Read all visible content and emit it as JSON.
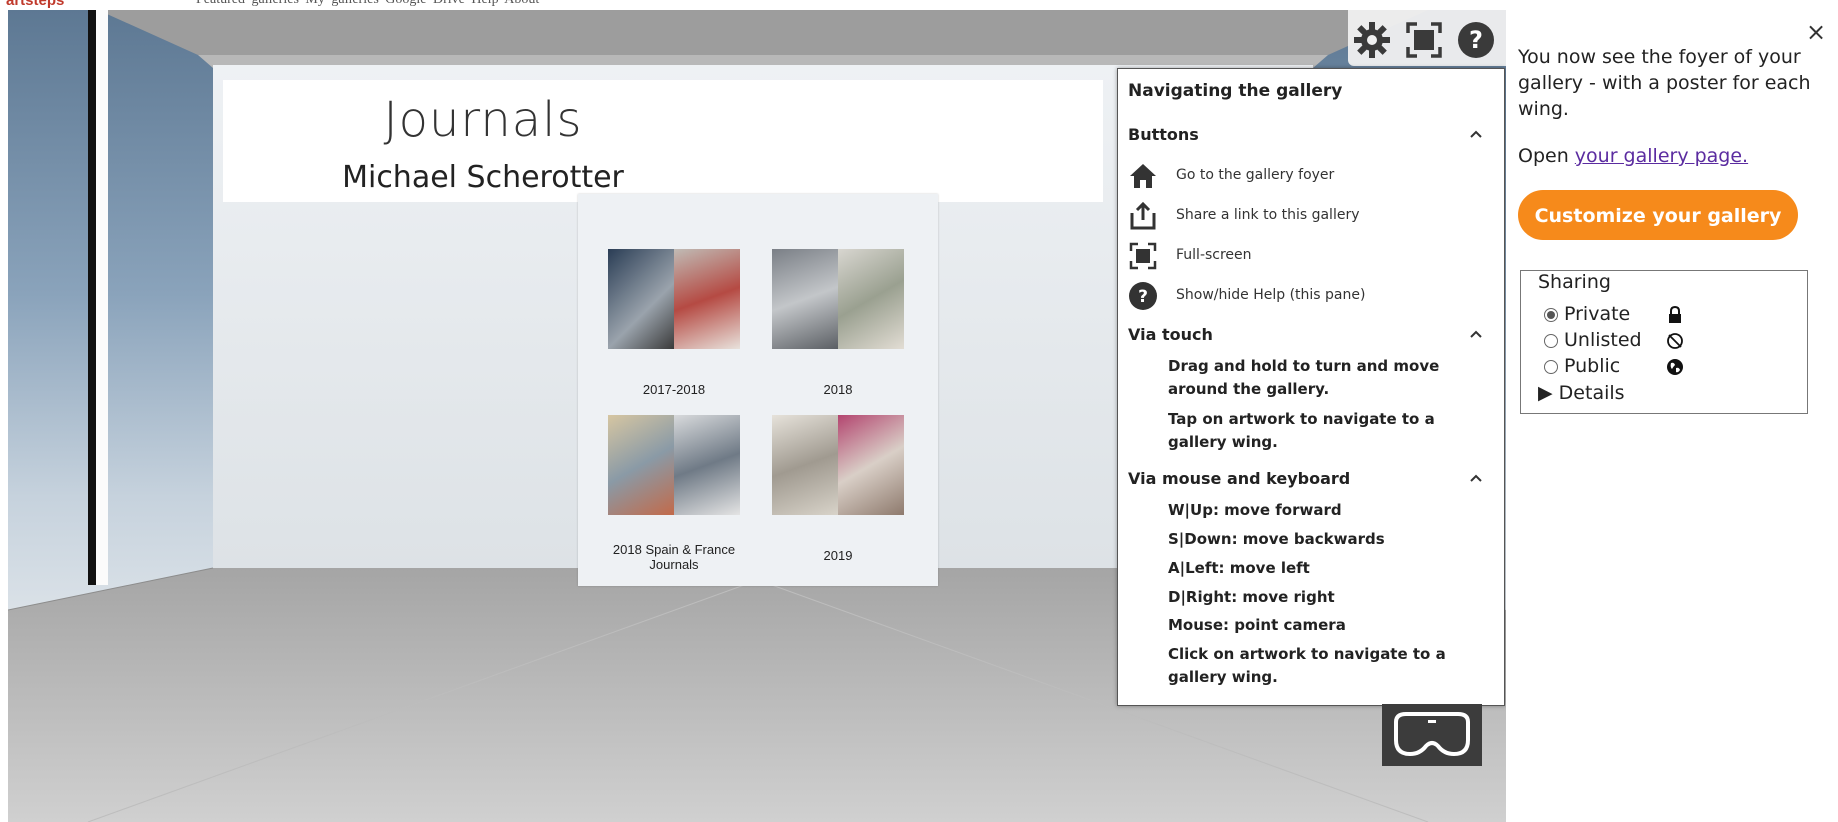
{
  "top_strip": {
    "logo": "artsteps",
    "nav": "Featured galleries   My galleries   Google Drive   Help   About"
  },
  "gallery": {
    "banner_title": "Journals",
    "banner_subtitle": "Michael Scherotter",
    "poster_items": [
      {
        "label": "2017-2018"
      },
      {
        "label": "2018"
      },
      {
        "label": "2018 Spain & France Journals"
      },
      {
        "label": "2019"
      }
    ]
  },
  "toolbar": {
    "icons": [
      "gear-icon",
      "fullscreen-icon",
      "help-icon"
    ]
  },
  "help_pane": {
    "title": "Navigating the gallery",
    "sections": {
      "buttons": "Buttons",
      "touch": "Via touch",
      "mouse": "Via mouse and keyboard"
    },
    "buttons": [
      {
        "icon": "home-icon",
        "text": "Go to the gallery foyer"
      },
      {
        "icon": "share-icon",
        "text": "Share a link to this gallery"
      },
      {
        "icon": "fullscreen-icon",
        "text": "Full-screen"
      },
      {
        "icon": "help-icon",
        "text": "Show/hide Help (this pane)"
      }
    ],
    "touch": [
      "Drag and hold to turn and move around the gallery.",
      "Tap on artwork to navigate to a gallery wing."
    ],
    "mouse": [
      "W|Up: move forward",
      "S|Down: move backwards",
      "A|Left: move left",
      "D|Right: move right",
      "Mouse: point camera",
      "Click on artwork to navigate to a gallery wing."
    ]
  },
  "side_panel": {
    "close": "×",
    "intro": "You now see the foyer of your gallery - with a poster for each wing.",
    "open_prefix": "Open ",
    "open_link": "your gallery page.",
    "customize_button": "Customize your gallery",
    "sharing": {
      "legend": "Sharing",
      "options": [
        {
          "label": "Private",
          "selected": true,
          "icon": "lock-icon"
        },
        {
          "label": "Unlisted",
          "selected": false,
          "icon": "unlisted-icon"
        },
        {
          "label": "Public",
          "selected": false,
          "icon": "globe-icon"
        }
      ],
      "details": "Details"
    }
  },
  "colors": {
    "accent": "#f68a1b",
    "link": "#5b2ca0"
  }
}
